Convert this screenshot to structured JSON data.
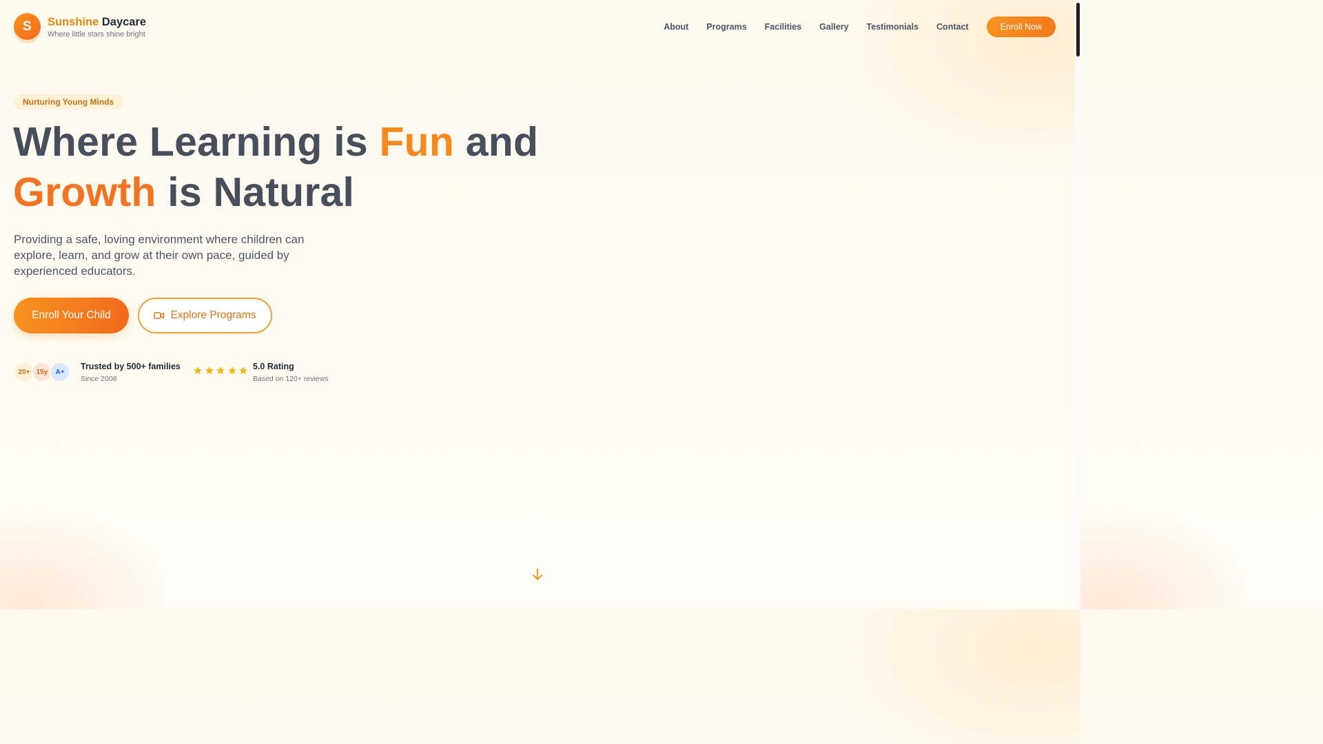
{
  "brand": {
    "logo_letter": "S",
    "name_part1": "Sunshine",
    "name_part2": "Daycare",
    "tagline": "Where little stars shine bright"
  },
  "nav": {
    "items": [
      "About",
      "Programs",
      "Facilities",
      "Gallery",
      "Testimonials",
      "Contact"
    ],
    "cta_label": "Enroll Now"
  },
  "hero": {
    "badge": "Nurturing Young Minds",
    "headline": {
      "part1": "Where Learning is ",
      "highlight1": "Fun",
      "part2": " and",
      "highlight2": "Growth",
      "part3": " is Natural"
    },
    "description": "Providing a safe, loving environment where children can explore, learn, and grow at their own pace, guided by experienced educators.",
    "primary_button": "Enroll Your Child",
    "secondary_button": "Explore Programs",
    "secondary_button_icon": "video-camera-icon"
  },
  "trust": {
    "bubbles": [
      "20+",
      "15y",
      "A+"
    ],
    "families_title": "Trusted by 500+ families",
    "families_sub": "Since 2008",
    "star_count": 5,
    "rating_title": "5.0 Rating",
    "rating_sub": "Based on 120+ reviews"
  },
  "scroll_icon": "arrow-down-icon",
  "colors": {
    "accent": "#f7931e",
    "accent_dark": "#f26a1b",
    "text": "#4b5563",
    "heading": "#1f2937",
    "star": "#f5b50a"
  }
}
